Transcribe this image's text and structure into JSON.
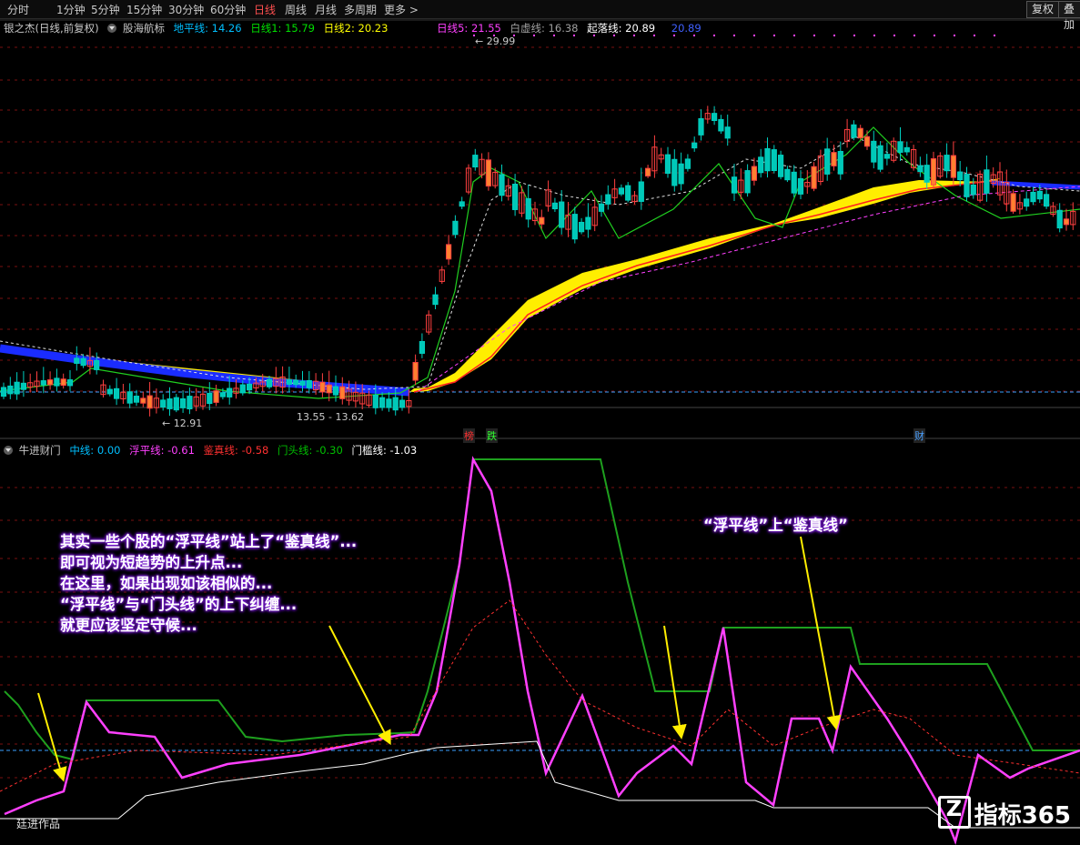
{
  "toolbar": {
    "tabs": [
      "分时",
      "1分钟",
      "5分钟",
      "15分钟",
      "30分钟",
      "60分钟",
      "日线",
      "周线",
      "月线",
      "多周期",
      "更多"
    ],
    "active_tab": "日线",
    "more_arrow": ">",
    "restore_button": "复权",
    "overlay_button": "叠加"
  },
  "main_panel": {
    "stock_name": "银之杰(日线,前复权)",
    "indicator_name": "股海航标",
    "lines": [
      {
        "label": "地平线: 14.26",
        "color": "#00bfff"
      },
      {
        "label": "日线1: 15.79",
        "color": "#00e000"
      },
      {
        "label": "日线2: 20.23",
        "color": "#ffff00"
      },
      {
        "label": "日线5: 21.55",
        "color": "#ff40ff"
      },
      {
        "label": "白虚线: 16.38",
        "color": "#a0a0a0"
      },
      {
        "label": "起落线: 20.89",
        "color": "#ffffff"
      },
      {
        "label": "20.89",
        "color": "#4060ff"
      }
    ],
    "annotations": {
      "high": "29.99",
      "low1": "12.91",
      "low2": "13.55 - 13.62"
    },
    "markers": [
      {
        "text": "榜",
        "color": "#ff3030"
      },
      {
        "text": "跌",
        "color": "#30ff30"
      },
      {
        "text": "财",
        "color": "#4aa0ff"
      }
    ]
  },
  "sub_panel": {
    "indicator_name": "牛进财门",
    "lines": [
      {
        "label": "中线: 0.00",
        "color": "#00bfff"
      },
      {
        "label": "浮平线: -0.61",
        "color": "#ff40ff"
      },
      {
        "label": "鉴真线: -0.58",
        "color": "#ff3030"
      },
      {
        "label": "门头线: -0.30",
        "color": "#00c000"
      },
      {
        "label": "门槛线: -1.03",
        "color": "#ffffff"
      }
    ],
    "author": "廷进作品"
  },
  "notes": {
    "left": [
      "其实一些个股的“浮平线”站上了“鉴真线”...",
      "即可视为短趋势的上升点...",
      "在这里，如果出现如该相似的...",
      "“浮平线”与“门头线”的上下纠缠...",
      "就更应该坚定守候..."
    ],
    "right": "“浮平线”上“鉴真线”"
  },
  "watermark": "指标365"
}
